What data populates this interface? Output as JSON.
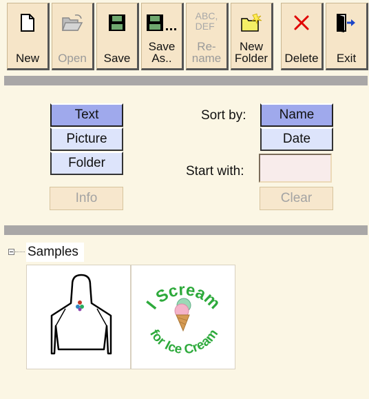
{
  "toolbar": {
    "buttons": [
      {
        "label": "New",
        "icon": "new-document-icon",
        "enabled": true
      },
      {
        "label": "Open",
        "icon": "open-folder-icon",
        "enabled": false
      },
      {
        "label": "Save",
        "icon": "floppy-disk-icon",
        "enabled": true
      },
      {
        "label": "Save\nAs..",
        "icon": "save-as-icon",
        "enabled": true
      },
      {
        "label": "Re-\nname",
        "icon": "rename-icon",
        "enabled": false
      },
      {
        "label": "New\nFolder",
        "icon": "new-folder-icon",
        "enabled": true
      },
      {
        "label": "Delete",
        "icon": "delete-x-icon",
        "enabled": true
      },
      {
        "label": "Exit",
        "icon": "exit-door-icon",
        "enabled": true
      }
    ],
    "rename_icon_text": "ABC,\nDEF"
  },
  "filters": {
    "text_label": "Text",
    "picture_label": "Picture",
    "folder_label": "Folder",
    "info_label": "Info",
    "selected": "Text"
  },
  "sort": {
    "label": "Sort by:",
    "name_label": "Name",
    "date_label": "Date",
    "selected": "Name"
  },
  "start_with": {
    "label": "Start with:",
    "value": "",
    "clear_label": "Clear"
  },
  "tree": {
    "folder_name": "Samples",
    "expanded": true,
    "items": [
      {
        "name": "apron-design"
      },
      {
        "name": "i-scream-ice-cream-design",
        "text_top": "I Scream",
        "text_bottom": "for Ice Cream"
      }
    ]
  },
  "colors": {
    "background": "#fbf6e4",
    "button_face": "#f6e5c8",
    "selected_option": "#9fa9ec",
    "option": "#dde4fb",
    "separator": "#a9a7a7",
    "delete_red": "#e00000",
    "embroidery_green": "#2eaa3c"
  }
}
